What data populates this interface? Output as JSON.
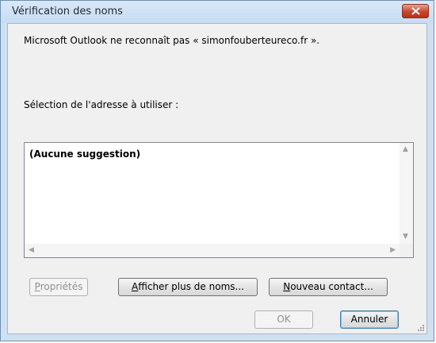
{
  "window": {
    "title": "Vérification des noms"
  },
  "message": "Microsoft Outlook ne reconnaît pas « simonfouberteureco.fr ».",
  "selection_label": "Sélection de l'adresse à utiliser :",
  "list": {
    "items": [
      "(Aucune suggestion)"
    ]
  },
  "buttons": {
    "properties": {
      "mnemonic": "P",
      "rest": "ropriétés"
    },
    "more_names": {
      "mnemonic": "A",
      "rest": "fficher plus de noms..."
    },
    "new_contact": {
      "mnemonic": "N",
      "rest": "ouveau contact..."
    },
    "ok": "OK",
    "cancel": "Annuler"
  },
  "colors": {
    "close_button": "#c8452d",
    "titlebar": "#d0e2f5"
  }
}
